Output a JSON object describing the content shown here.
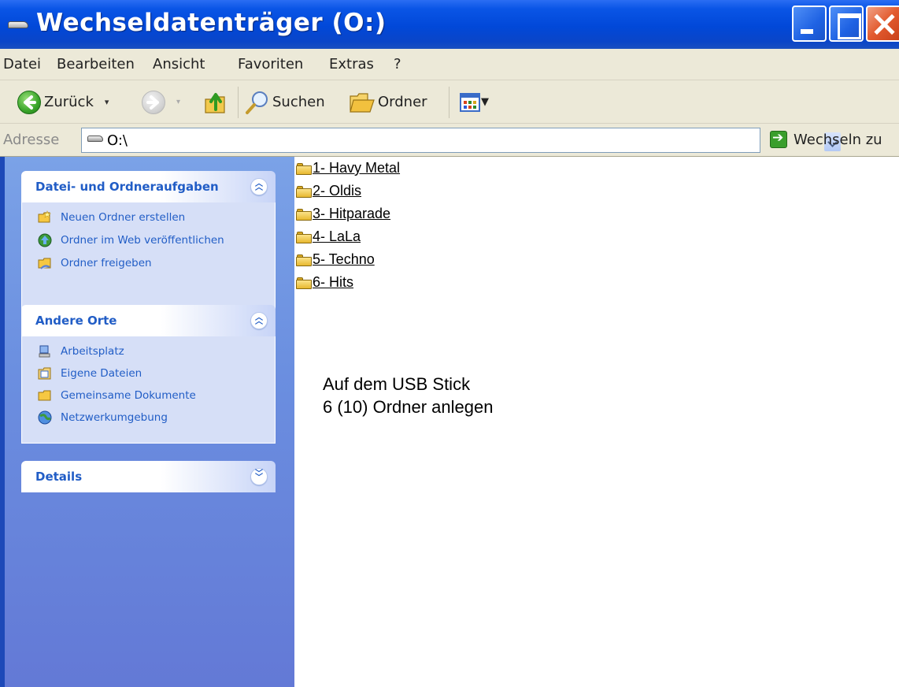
{
  "window": {
    "title": "Wechseldatenträger (O:)",
    "title_icon": "removable-drive-icon",
    "buttons": {
      "minimize": "minimize-icon",
      "maximize": "maximize-icon",
      "close": "close-icon"
    }
  },
  "menubar": {
    "items": [
      "Datei",
      "Bearbeiten",
      "Ansicht",
      "Favoriten",
      "Extras",
      "?"
    ]
  },
  "toolbar": {
    "back_label": "Zurück",
    "search_label": "Suchen",
    "folders_label": "Ordner"
  },
  "address": {
    "label": "Adresse",
    "value": "O:\\",
    "go_label": "Wechseln zu"
  },
  "taskpane": {
    "panels": [
      {
        "title": "Datei- und Ordneraufgaben",
        "expanded": true,
        "items": [
          {
            "label": "Neuen Ordner erstellen",
            "icon": "new-folder-icon"
          },
          {
            "label": "Ordner im Web veröffentlichen",
            "icon": "publish-web-icon"
          },
          {
            "label": "Ordner freigeben",
            "icon": "share-folder-icon"
          }
        ]
      },
      {
        "title": "Andere Orte",
        "expanded": true,
        "items": [
          {
            "label": "Arbeitsplatz",
            "icon": "my-computer-icon"
          },
          {
            "label": "Eigene Dateien",
            "icon": "my-documents-icon"
          },
          {
            "label": "Gemeinsame Dokumente",
            "icon": "shared-documents-icon"
          },
          {
            "label": "Netzwerkumgebung",
            "icon": "network-places-icon"
          }
        ]
      },
      {
        "title": "Details",
        "expanded": false,
        "items": []
      }
    ]
  },
  "folders": [
    "1- Havy Metal",
    "2- Oldis",
    "3- Hitparade",
    "4- LaLa",
    "5- Techno",
    "6- Hits"
  ],
  "note": {
    "line1": "Auf dem USB Stick",
    "line2": "6 (10) Ordner anlegen"
  }
}
